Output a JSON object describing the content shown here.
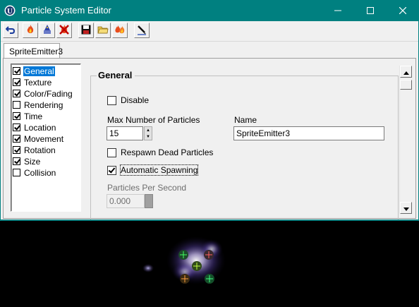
{
  "window": {
    "title": "Particle System Editor",
    "titlebar_color": "#008080",
    "controls": [
      "minimize-icon",
      "maximize-icon",
      "close-icon"
    ]
  },
  "toolbar": {
    "buttons": [
      {
        "name": "undo-button",
        "icon": "undo-icon"
      },
      {
        "name": "new-emitter-button",
        "icon": "fire-icon"
      },
      {
        "name": "emitter-properties-button",
        "icon": "wizard-icon"
      },
      {
        "name": "delete-emitter-button",
        "icon": "fire-delete-icon"
      },
      {
        "name": "save-button",
        "icon": "floppy-disk-icon"
      },
      {
        "name": "open-button",
        "icon": "folder-icon"
      },
      {
        "name": "duplicate-emitter-button",
        "icon": "fire-duplicate-icon"
      },
      {
        "name": "edit-button",
        "icon": "pen-icon"
      }
    ]
  },
  "tabs": [
    {
      "label": "SpriteEmitter3"
    }
  ],
  "categories": [
    {
      "label": "General",
      "checked": true,
      "selected": true
    },
    {
      "label": "Texture",
      "checked": true
    },
    {
      "label": "Color/Fading",
      "checked": true
    },
    {
      "label": "Rendering",
      "checked": false
    },
    {
      "label": "Time",
      "checked": true
    },
    {
      "label": "Location",
      "checked": true
    },
    {
      "label": "Movement",
      "checked": true
    },
    {
      "label": "Rotation",
      "checked": true
    },
    {
      "label": "Size",
      "checked": true
    },
    {
      "label": "Collision",
      "checked": false
    }
  ],
  "general": {
    "group_title": "General",
    "disable_label": "Disable",
    "disable_checked": false,
    "max_particles_label": "Max Number of Particles",
    "max_particles_value": "15",
    "name_label": "Name",
    "name_value": "SpriteEmitter3",
    "respawn_label": "Respawn Dead Particles",
    "respawn_checked": false,
    "auto_spawn_label": "Automatic Spawning",
    "auto_spawn_checked": true,
    "particles_per_second_label": "Particles Per Second",
    "particles_per_second_value": "0.000"
  },
  "colors": {
    "selection": "#0078d7",
    "viewport_bg": "#000000"
  }
}
